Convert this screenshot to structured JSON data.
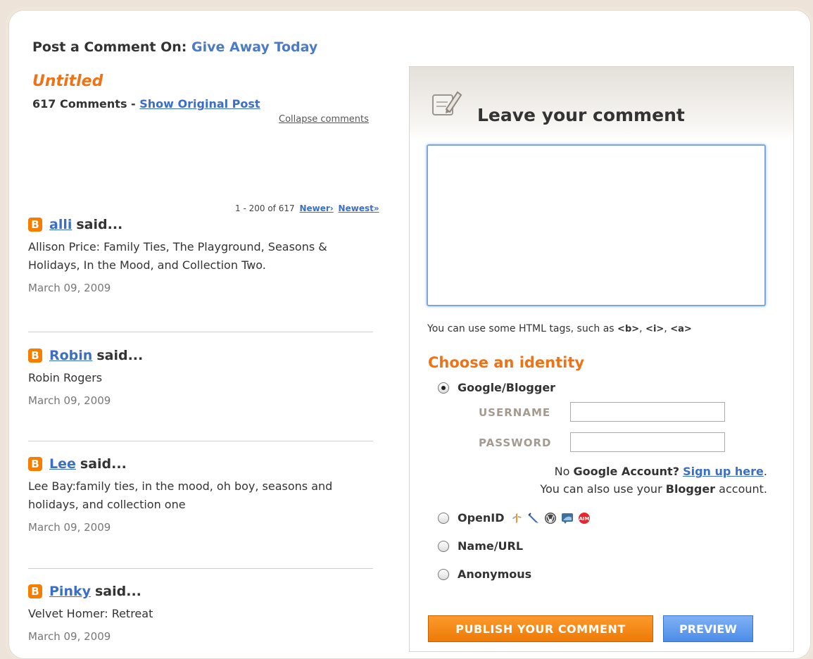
{
  "header": {
    "prefix": "Post a Comment On:",
    "blog_name": "Give Away Today"
  },
  "post": {
    "title": "Untitled",
    "comments_count": "617 Comments",
    "separator": "-",
    "show_original": "Show Original Post",
    "collapse": "Collapse comments"
  },
  "pager": {
    "range": "1 - 200 of 617",
    "newer": "Newer›",
    "newest": "Newest»"
  },
  "said": "said...",
  "comments": [
    {
      "author": "alli",
      "body": "Allison Price: Family Ties, The Playground, Seasons & Holidays, In the Mood, and Collection Two.",
      "date": "March 09, 2009"
    },
    {
      "author": "Robin",
      "body": "Robin Rogers",
      "date": "March 09, 2009"
    },
    {
      "author": "Lee",
      "body": "Lee Bay:family ties, in the mood, oh boy, seasons and holidays, and collection one",
      "date": "March 09, 2009"
    },
    {
      "author": "Pinky",
      "body": "Velvet Homer: Retreat",
      "date": "March 09, 2009"
    }
  ],
  "comment_form": {
    "title": "Leave your comment",
    "textarea_value": "",
    "html_hint_prefix": "You can use some HTML tags, such as",
    "html_tags": [
      "<b>",
      "<i>",
      "<a>"
    ],
    "identity_heading": "Choose an identity",
    "identities": [
      {
        "label": "Google/Blogger",
        "checked": true
      },
      {
        "label": "OpenID",
        "checked": false
      },
      {
        "label": "Name/URL",
        "checked": false
      },
      {
        "label": "Anonymous",
        "checked": false
      }
    ],
    "username_label": "USERNAME",
    "password_label": "PASSWORD",
    "username_value": "",
    "password_value": "",
    "signup_line1_prefix": "No",
    "signup_line1_bold": "Google Account?",
    "signup_link": "Sign up here",
    "signup_line1_suffix": ".",
    "signup_line2_prefix": "You can also use your",
    "signup_line2_bold": "Blogger",
    "signup_line2_suffix": "account.",
    "openid_icons": [
      "openid-icon",
      "livejournal-icon",
      "wordpress-icon",
      "typepad-icon",
      "aim-icon"
    ],
    "publish_button": "PUBLISH YOUR COMMENT",
    "preview_button": "PREVIEW"
  },
  "colors": {
    "accent_orange": "#ef7316",
    "link_blue": "#3b6ec8",
    "blogger_orange": "#f57d00"
  }
}
